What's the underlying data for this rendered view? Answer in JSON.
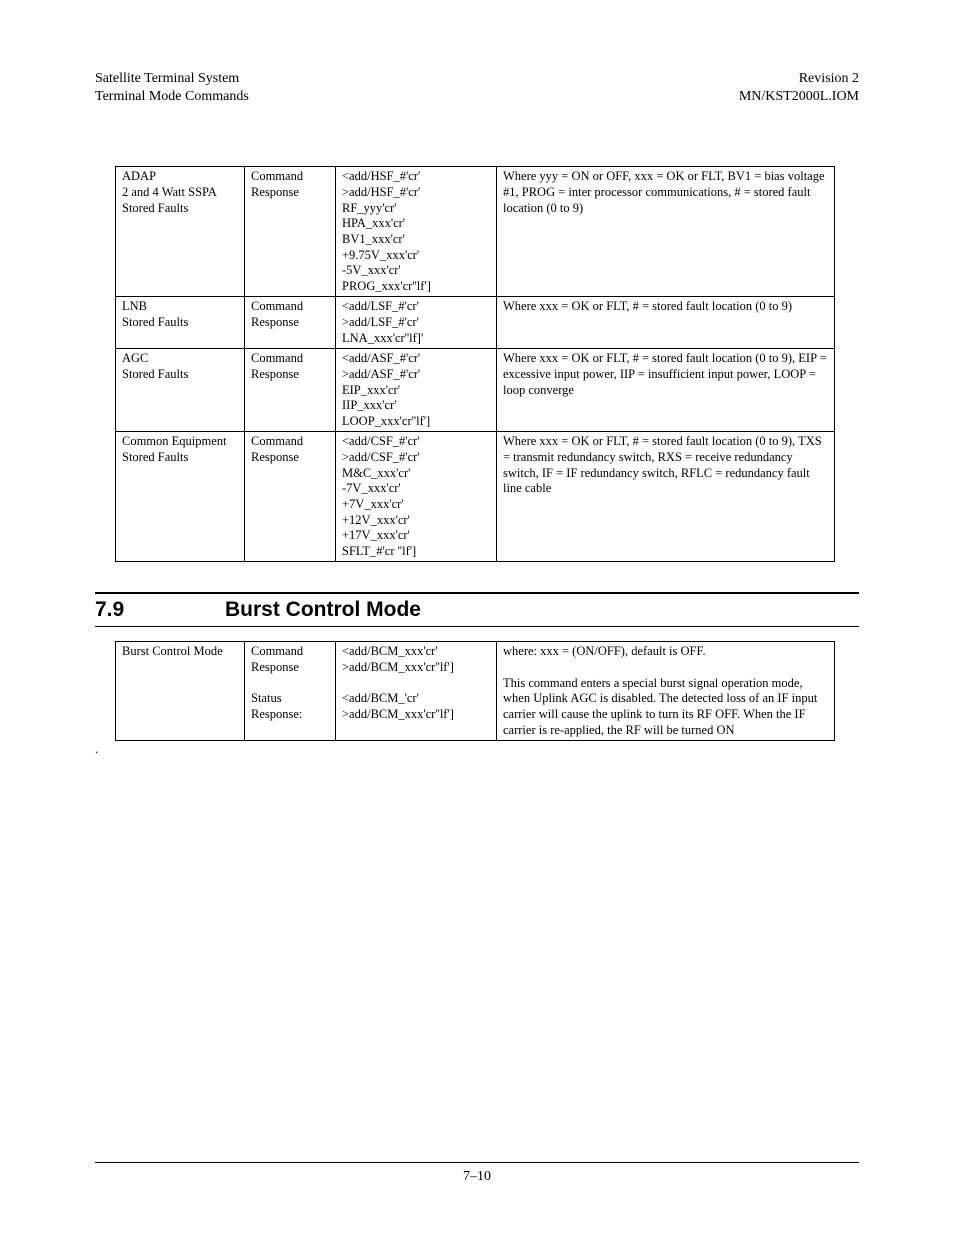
{
  "header": {
    "left1": "Satellite Terminal System",
    "left2": "Terminal Mode Commands",
    "right1": "Revision 2",
    "right2": "MN/KST2000L.IOM"
  },
  "table1": {
    "rows": [
      {
        "c1": "ADAP\n2 and 4 Watt SSPA\nStored Faults",
        "c2": "Command\nResponse",
        "c3": "<add/HSF_#'cr'\n>add/HSF_#'cr'\nRF_yyy'cr'\nHPA_xxx'cr'\nBV1_xxx'cr'\n+9.75V_xxx'cr'\n-5V_xxx'cr'\nPROG_xxx'cr''lf']",
        "c4": "Where yyy = ON or OFF, xxx = OK or FLT, BV1 = bias voltage #1, PROG = inter processor communications, # = stored fault location (0 to 9)"
      },
      {
        "c1": "LNB\nStored Faults",
        "c2": "Command\nResponse",
        "c3": "<add/LSF_#'cr'\n>add/LSF_#'cr'\nLNA_xxx'cr''lf]'",
        "c4": "Where xxx = OK or FLT, # = stored fault location (0 to 9)"
      },
      {
        "c1": "AGC\nStored Faults",
        "c2": "Command\nResponse",
        "c3": "<add/ASF_#'cr'\n>add/ASF_#'cr'\nEIP_xxx'cr'\nIIP_xxx'cr'\nLOOP_xxx'cr''lf']",
        "c4": "Where xxx = OK or FLT, # = stored fault location (0 to 9), EIP = excessive input power, IIP = insufficient input power, LOOP = loop converge"
      },
      {
        "c1": "Common Equipment\nStored Faults",
        "c2": "Command\nResponse",
        "c3": "<add/CSF_#'cr'\n>add/CSF_#'cr'\nM&C_xxx'cr'\n-7V_xxx'cr'\n+7V_xxx'cr'\n+12V_xxx'cr'\n+17V_xxx'cr'\nSFLT_#'cr ''lf']",
        "c4": "Where xxx = OK or FLT, # = stored fault location (0 to 9), TXS = transmit redundancy switch, RXS = receive redundancy switch, IF = IF redundancy switch, RFLC = redundancy fault line cable"
      }
    ]
  },
  "section": {
    "number": "7.9",
    "title": "Burst Control Mode"
  },
  "table2": {
    "rows": [
      {
        "c1": "Burst Control Mode",
        "c2": "Command\nResponse\n\nStatus\nResponse:",
        "c3": "<add/BCM_xxx'cr'\n>add/BCM_xxx'cr''lf']\n\n<add/BCM_'cr'\n>add/BCM_xxx'cr''lf']",
        "c4": "where: xxx = (ON/OFF), default is OFF.\n\nThis command enters a special burst signal operation mode, when Uplink AGC is disabled. The detected loss of an IF input carrier will cause the uplink to turn its RF OFF. When the IF carrier is re-applied, the RF will be turned ON"
      }
    ]
  },
  "footer": {
    "page": "7–10"
  }
}
